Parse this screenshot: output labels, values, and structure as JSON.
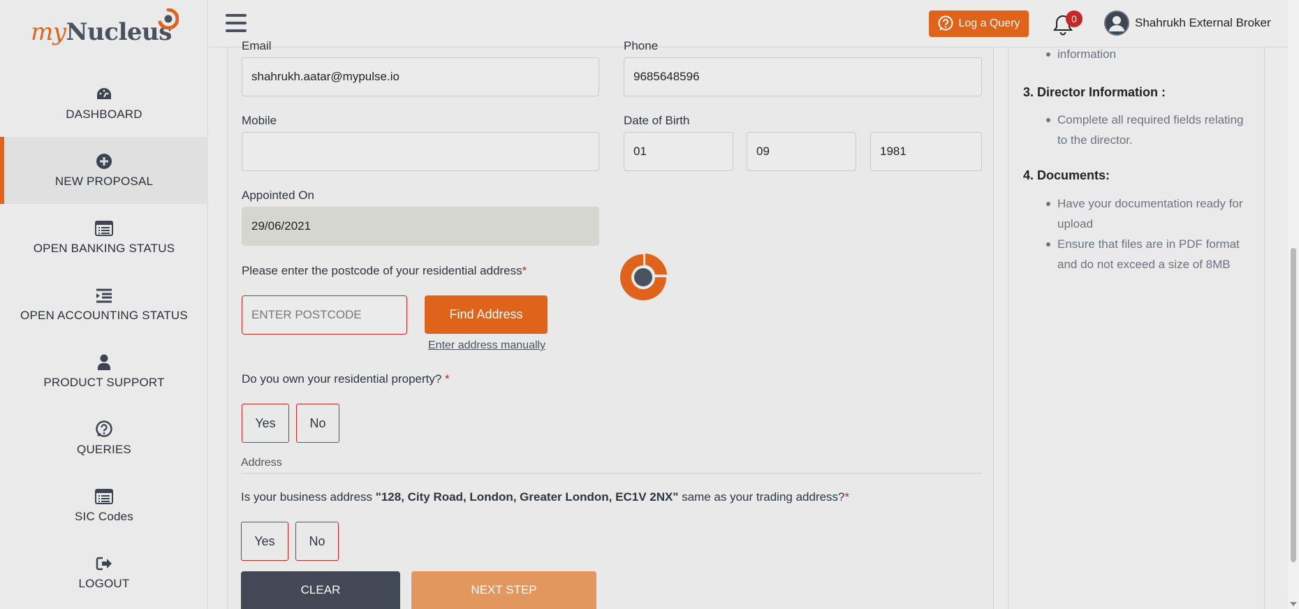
{
  "brand": {
    "logo_my": "my",
    "logo_nucleus": "Nucleus",
    "accent": "#e0631c"
  },
  "sidebar": {
    "items": [
      {
        "label": "DASHBOARD",
        "icon": "dashboard-gauge-icon",
        "active": false
      },
      {
        "label": "NEW PROPOSAL",
        "icon": "plus-circle-icon",
        "active": true
      },
      {
        "label": "OPEN BANKING STATUS",
        "icon": "list-window-icon",
        "active": false
      },
      {
        "label": "OPEN ACCOUNTING STATUS",
        "icon": "indent-list-icon",
        "active": false
      },
      {
        "label": "PRODUCT SUPPORT",
        "icon": "user-icon",
        "active": false
      },
      {
        "label": "QUERIES",
        "icon": "question-circle-icon",
        "active": false
      },
      {
        "label": "SIC Codes",
        "icon": "list-window-icon",
        "active": false
      },
      {
        "label": "LOGOUT",
        "icon": "logout-icon",
        "active": false
      }
    ]
  },
  "topbar": {
    "log_query_label": "Log a Query",
    "notification_count": "0",
    "user_name": "Shahrukh External Broker"
  },
  "form": {
    "email_label": "Email",
    "email_value": "shahrukh.aatar@mypulse.io",
    "phone_label": "Phone",
    "phone_value": "9685648596",
    "mobile_label": "Mobile",
    "mobile_value": "",
    "dob_label": "Date of Birth",
    "dob_day": "01",
    "dob_month": "09",
    "dob_year": "1981",
    "appointed_label": "Appointed On",
    "appointed_value": "29/06/2021",
    "postcode_question": "Please enter the postcode of your residential address",
    "required_mark": "*",
    "postcode_placeholder": "ENTER POSTCODE",
    "find_address_label": "Find Address",
    "manual_address_link": "Enter address manually",
    "own_property_question": "Do you own your residential property? ",
    "yes_label": "Yes",
    "no_label": "No",
    "address_section_title": "Address",
    "business_q_prefix": "Is your business address ",
    "business_q_address": "\"128, City Road, London, Greater London, EC1V 2NX\"",
    "business_q_suffix": " same as your trading address?",
    "clear_label": "CLEAR",
    "next_label": "NEXT STEP"
  },
  "help": {
    "item_top": "information",
    "director_heading": "3. Director Information :",
    "director_points": [
      "Complete all required fields relating to the director."
    ],
    "documents_heading": "4. Documents:",
    "documents_points": [
      "Have your documentation ready for upload",
      "Ensure that files are in PDF format and do not exceed a size of 8MB"
    ]
  }
}
